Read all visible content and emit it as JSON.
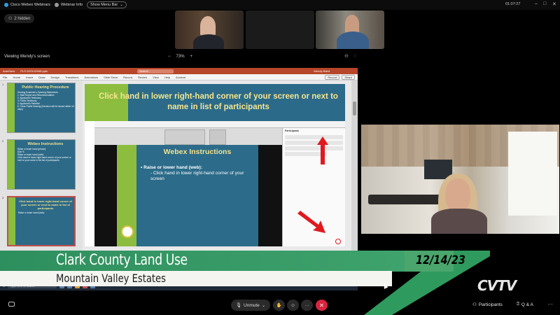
{
  "topbar": {
    "app_name": "Cisco Webex Webinars",
    "webinar_info": "Webinar Info",
    "show_menu": "Show Menu Bar",
    "clock": "01:07:27"
  },
  "hidden_chip": "2 hidden",
  "share": {
    "viewing_label": "Viewing Wendy's screen",
    "zoom_minus": "−",
    "zoom_level": "73%",
    "zoom_plus": "+"
  },
  "powerpoint": {
    "autosave": "AutoSave",
    "file_title": "PLS 2023-00045.pptx",
    "user": "Wendy Baird",
    "search": "Search",
    "ribbon_tabs": [
      "File",
      "Home",
      "Insert",
      "Draw",
      "Design",
      "Transitions",
      "Animations",
      "Slide Show",
      "Record",
      "Review",
      "View",
      "Help",
      "Acrobat"
    ],
    "record_btn": "Record",
    "share_btn": "Share",
    "thumbs": [
      {
        "num": "1",
        "title": "Public Hearing Procedure",
        "lines": [
          "Hearing Examiner's Opening Statements",
          "1. Staff Report and Recommendation",
          "2. Applicant's Testimony",
          "3. Public Testimony",
          "4. Applicant's Rebuttal",
          "5. Close Public Hearing (Decision will be issued within 14 days)"
        ]
      },
      {
        "num": "2",
        "title": "Webex Instructions",
        "lines": [
          "Raise or lower hand (phone):",
          "Dial *3",
          "Raise or lower hand (web):",
          "Click hand in lower right-hand corner of your screen or next to your name in the list of participants"
        ]
      },
      {
        "num": "3",
        "title": "Click hand in lower right-hand corner of your screen or next to name in list of participants",
        "lines": [
          "Raise or lower hand (web):"
        ]
      }
    ],
    "main_title": "Click hand in lower right-hand corner of your screen or next to name in list of participants",
    "inner_slide": {
      "title": "Webex Instructions",
      "bullet_main": "Raise or lower hand (web):",
      "bullet_sub": "Click hand in lower right-hand corner of your screen"
    },
    "inner_panel_title": "Participants"
  },
  "taskbar": {
    "search": "Type here to search"
  },
  "lower_third": {
    "title": "Clark County Land Use",
    "subtitle": "Mountain Valley Estates",
    "date": "12/14/23"
  },
  "logo": "CVTV",
  "controls": {
    "unmute": "Unmute",
    "participants": "Participants",
    "qa": "Q & A",
    "more": "···",
    "end_icon": "✕"
  },
  "colors": {
    "accent_green": "#3fa36d",
    "slide_blue": "#2b6a89",
    "slide_title_yellow": "#f4e690",
    "end_red": "#d7263d"
  }
}
